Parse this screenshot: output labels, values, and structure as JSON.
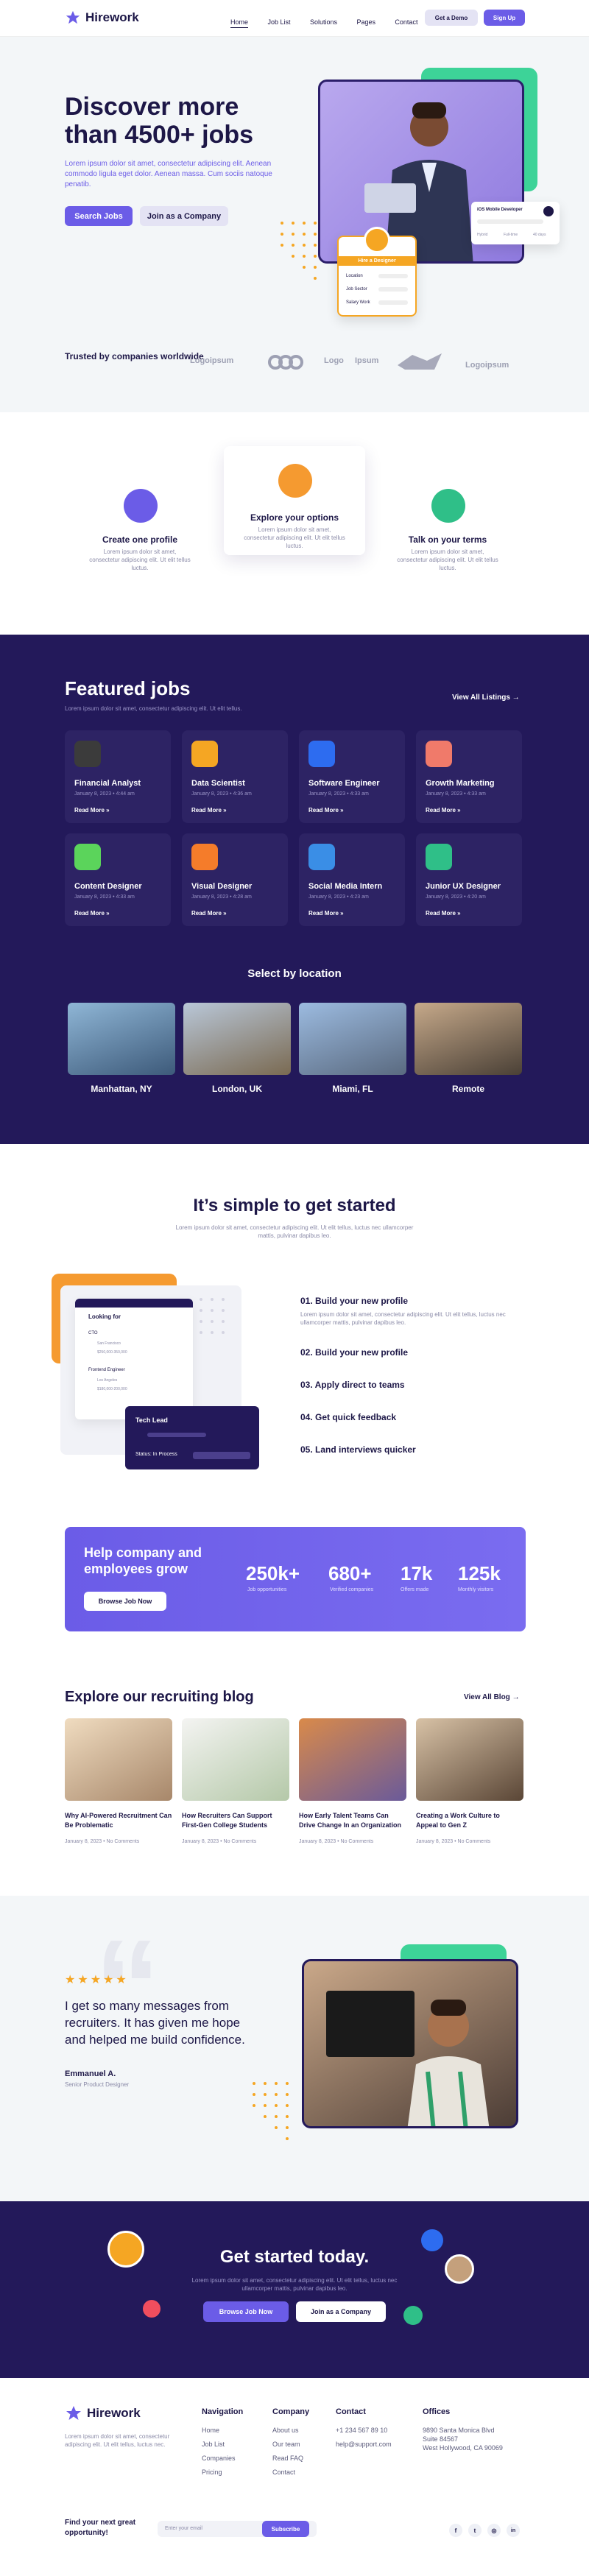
{
  "header": {
    "brand": "Hirework",
    "nav": [
      "Home",
      "Job List",
      "Solutions",
      "Pages",
      "Contact"
    ],
    "demo_label": "Get a Demo",
    "signup_label": "Sign Up"
  },
  "hero": {
    "title": "Discover more than 4500+ jobs",
    "subtitle": "Lorem ipsum dolor sit amet, consectetur adipiscing elit. Aenean commodo ligula eget dolor. Aenean massa. Cum sociis natoque penatib.",
    "search_label": "Search Jobs",
    "join_label": "Join as a Company",
    "card_title": "Hire a Designer",
    "card_rows": [
      "Location",
      "Job Sector",
      "Salary Work"
    ],
    "dev_card_title": "iOS Mobile Developer",
    "dev_card_tags": [
      "Hybrid",
      "Full-time",
      "40 days"
    ]
  },
  "trusted": {
    "label": "Trusted by companies worldwide",
    "logos": [
      "Logoipsum",
      "Logo",
      "Ipsum",
      "Logoipsum"
    ]
  },
  "features": [
    {
      "title": "Create one profile",
      "text": "Lorem ipsum dolor sit amet, consectetur adipiscing elit. Ut elit tellus luctus.",
      "color": "#6b5ce7"
    },
    {
      "title": "Explore your options",
      "text": "Lorem ipsum dolor sit amet, consectetur adipiscing elit. Ut elit tellus luctus.",
      "color": "#f59a30"
    },
    {
      "title": "Talk on your terms",
      "text": "Lorem ipsum dolor sit amet, consectetur adipiscing elit. Ut elit tellus luctus.",
      "color": "#2fbf88"
    }
  ],
  "featured": {
    "title": "Featured jobs",
    "subtitle": "Lorem ipsum dolor sit amet, consectetur adipiscing elit. Ut elit tellus.",
    "view_all": "View All Listings",
    "jobs": [
      {
        "title": "Financial Analyst",
        "date": "January 8, 2023 • 4:44 am",
        "color": "#3b3b3b"
      },
      {
        "title": "Data Scientist",
        "date": "January 8, 2023 • 4:36 am",
        "color": "#f5a623"
      },
      {
        "title": "Software Engineer",
        "date": "January 8, 2023 • 4:33 am",
        "color": "#2d6cf0"
      },
      {
        "title": "Growth Marketing",
        "date": "January 8, 2023 • 4:33 am",
        "color": "#f07a6a"
      },
      {
        "title": "Content Designer",
        "date": "January 8, 2023 • 4:33 am",
        "color": "#5bd45b"
      },
      {
        "title": "Visual Designer",
        "date": "January 8, 2023 • 4:28 am",
        "color": "#f57c2a"
      },
      {
        "title": "Social Media Intern",
        "date": "January 8, 2023 • 4:23 am",
        "color": "#3a8ee6"
      },
      {
        "title": "Junior UX Designer",
        "date": "January 8, 2023 • 4:20 am",
        "color": "#2fbf88"
      }
    ],
    "read_more": "Read More »"
  },
  "locations": {
    "title": "Select by location",
    "items": [
      "Manhattan, NY",
      "London, UK",
      "Miami, FL",
      "Remote"
    ]
  },
  "simple": {
    "title": "It’s simple to get started",
    "subtitle": "Lorem ipsum dolor sit amet, consectetur adipiscing elit. Ut elit tellus, luctus nec ullamcorper mattis, pulvinar dapibus leo.",
    "steps": [
      "01. Build your new profile",
      "02. Build your new profile",
      "03. Apply direct to teams",
      "04. Get quick feedback",
      "05. Land interviews quicker"
    ],
    "step_text": "Lorem ipsum dolor sit amet, consectetur adipiscing elit. Ut elit tellus, luctus nec ullamcorper mattis, pulvinar dapibus leo.",
    "mock_looking": "Looking for",
    "mock_rows": [
      "CTO",
      "San Francisco",
      "$250,000-350,000",
      "Frontend Engineer",
      "Los Angeles",
      "$180,000-200,000"
    ],
    "mock_lead": "Tech Lead",
    "mock_status": "Status: In Process"
  },
  "stats": {
    "title": "Help company and employees grow",
    "cta": "Browse Job Now",
    "items": [
      {
        "value": "250k+",
        "label": "Job opportunities"
      },
      {
        "value": "680+",
        "label": "Verified companies"
      },
      {
        "value": "17k",
        "label": "Offers made"
      },
      {
        "value": "125k",
        "label": "Monthly visitors"
      }
    ]
  },
  "blog": {
    "title": "Explore our recruiting blog",
    "view_all": "View All Blog",
    "posts": [
      {
        "title": "Why AI-Powered Recruitment Can Be Problematic",
        "meta": "January 8, 2023 • No Comments"
      },
      {
        "title": "How Recruiters Can Support First-Gen College Students",
        "meta": "January 8, 2023 • No Comments"
      },
      {
        "title": "How Early Talent Teams Can Drive Change In an Organization",
        "meta": "January 8, 2023 • No Comments"
      },
      {
        "title": "Creating a Work Culture to Appeal to Gen Z",
        "meta": "January 8, 2023 • No Comments"
      }
    ]
  },
  "testimonial": {
    "stars": "★★★★★",
    "quote": "I get so many messages from recruiters. It has given me hope and helped me build confidence.",
    "name": "Emmanuel A.",
    "role": "Senior Product Designer"
  },
  "cta": {
    "title": "Get started today.",
    "subtitle": "Lorem ipsum dolor sit amet, consectetur adipiscing elit. Ut elit tellus, luctus nec ullamcorper mattis, pulvinar dapibus leo.",
    "browse": "Browse Job Now",
    "join": "Join as a Company"
  },
  "footer": {
    "brand": "Hirework",
    "about": "Lorem ipsum dolor sit amet, consectetur adipiscing elit. Ut elit tellus, luctus nec.",
    "nav_title": "Navigation",
    "nav_items": [
      "Home",
      "Job List",
      "Companies",
      "Pricing"
    ],
    "company_title": "Company",
    "company_items": [
      "About us",
      "Our team",
      "Read FAQ",
      "Contact"
    ],
    "contact_title": "Contact",
    "contact_items": [
      "+1 234 567 89 10",
      "help@support.com"
    ],
    "offices_title": "Offices",
    "offices_items": [
      "9890 Santa Monica Blvd",
      "Suite 84567",
      "West Hollywood, CA 90069"
    ],
    "newsletter": "Find your next great opportunity!",
    "email_placeholder": "Enter your email",
    "subscribe": "Subscribe",
    "social": [
      "f",
      "t",
      "◎",
      "in"
    ]
  }
}
